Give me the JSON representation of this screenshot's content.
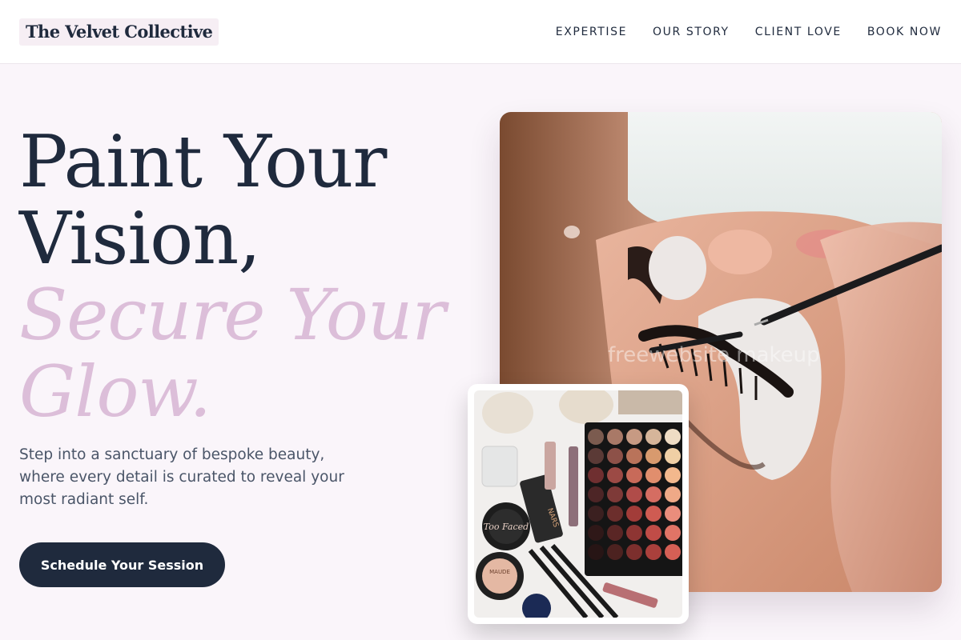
{
  "header": {
    "logo": "The Velvet Collective",
    "nav": [
      "EXPERTISE",
      "OUR STORY",
      "CLIENT LOVE",
      "BOOK NOW"
    ]
  },
  "hero": {
    "line1": "Paint Your",
    "line2": "Vision,",
    "line3": "Secure Your",
    "line4": "Glow.",
    "subtitle": "Step into a sanctuary of bespoke beauty, where every detail is curated to reveal your most radiant self.",
    "cta": "Schedule Your Session"
  },
  "images": {
    "main": "lash-extension-application-photo",
    "main_watermark": "freewebsite makeup",
    "inset": "makeup-products-flatlay-photo",
    "inset_labels": [
      "Too Faced",
      "NARS",
      "MAUDE"
    ]
  },
  "colors": {
    "navy": "#1f2a3d",
    "accent_pink": "#dcbed9",
    "background": "#faf5fa"
  }
}
